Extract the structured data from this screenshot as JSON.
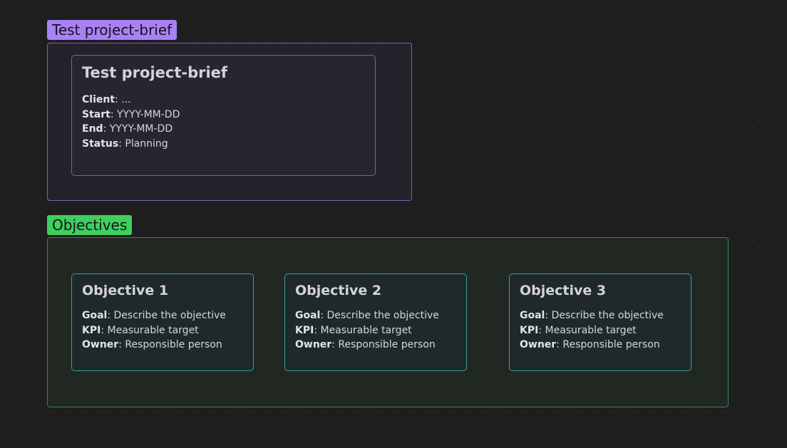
{
  "brief": {
    "group_label": "Test project-brief",
    "title": "Test project-brief",
    "fields": [
      {
        "key": "Client",
        "value": ": ..."
      },
      {
        "key": "Start",
        "value": ": YYYY-MM-DD"
      },
      {
        "key": "End",
        "value": ": YYYY-MM-DD"
      },
      {
        "key": "Status",
        "value": ": Planning"
      }
    ]
  },
  "objectives": {
    "group_label": "Objectives",
    "cards": [
      {
        "title": "Objective 1",
        "fields": [
          {
            "key": "Goal",
            "value": ": Describe the objective"
          },
          {
            "key": "KPI",
            "value": ": Measurable target"
          },
          {
            "key": "Owner",
            "value": ": Responsible person"
          }
        ]
      },
      {
        "title": "Objective 2",
        "fields": [
          {
            "key": "Goal",
            "value": ": Describe the objective"
          },
          {
            "key": "KPI",
            "value": ": Measurable target"
          },
          {
            "key": "Owner",
            "value": ": Responsible person"
          }
        ]
      },
      {
        "title": "Objective 3",
        "fields": [
          {
            "key": "Goal",
            "value": ": Describe the objective"
          },
          {
            "key": "KPI",
            "value": ": Measurable target"
          },
          {
            "key": "Owner",
            "value": ": Responsible person"
          }
        ]
      }
    ]
  },
  "colors": {
    "canvas_bg": "#1e1e1e",
    "brief_accent": "#a882f5",
    "objectives_accent": "#3ecf5f",
    "card_border_teal": "#3a9e9a"
  }
}
